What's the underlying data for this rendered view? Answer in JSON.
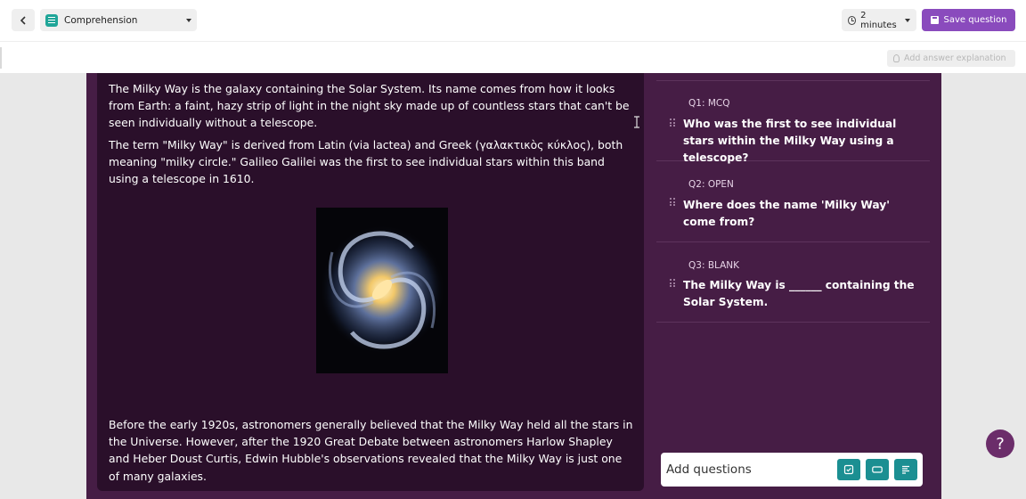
{
  "header": {
    "question_type": "Comprehension",
    "time_limit": "2 minutes",
    "save_label": "Save question"
  },
  "toolbar": {
    "explanation_label": "Add answer explanation"
  },
  "passage": {
    "paragraph_1": "The Milky Way is the galaxy containing the Solar System. Its name comes from how it looks from Earth: a faint, hazy strip of light in the night sky made up of countless stars that can't be seen individually without a telescope.",
    "paragraph_2": "The term \"Milky Way\" is derived from Latin (via lactea) and Greek (γαλακτικὸς κύκλος), both meaning \"milky circle.\" Galileo Galilei was the first to see individual stars within this band using a telescope in 1610.",
    "paragraph_3": "Before the early 1920s, astronomers generally believed that the Milky Way held all the stars in the Universe. However, after the 1920 Great Debate between astronomers Harlow Shapley and Heber Doust Curtis, Edwin Hubble's observations revealed that the Milky Way is just one of many galaxies."
  },
  "questions": [
    {
      "tag": "Q1: MCQ",
      "text": "Who was the first to see individual stars within the Milky Way using a telescope?"
    },
    {
      "tag": "Q2: OPEN",
      "text": "Where does the name 'Milky Way' come from?"
    },
    {
      "tag": "Q3: BLANK",
      "text": "The Milky Way is ______ containing the Solar System."
    }
  ],
  "add_questions": {
    "label": "Add questions"
  },
  "help": {
    "label": "?"
  },
  "icons": {
    "back": "chevron-left-icon",
    "type": "document-icon",
    "time": "clock-icon",
    "save": "save-icon",
    "explanation": "lightbulb-icon",
    "drag": "drag-handle-icon",
    "mcq": "checkbox-icon",
    "open": "text-box-icon",
    "blank": "text-lines-icon"
  },
  "colors": {
    "accent": "#8a4bbd",
    "panel": "#461d45",
    "passage_bg": "#2a0f2a",
    "teal": "#1b8f92"
  }
}
